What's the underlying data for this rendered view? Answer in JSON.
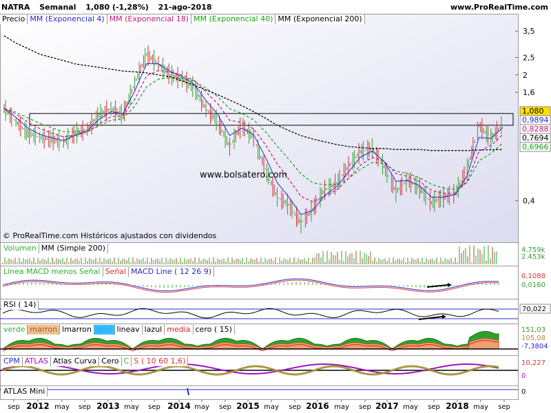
{
  "header": {
    "symbol": "NATRA",
    "period": "Semanal",
    "quote": "1,080 (-1,28%)",
    "date": "21-ago-2018",
    "site": "www.ProRealTime.com"
  },
  "watermark": "www.bolsatero.com",
  "footer_note": "© ProRealTime.com  Históricos ajustados con dividendos",
  "colors": {
    "ema4": "#2a2ac8",
    "ema18": "#c81478",
    "ema40": "#14a014",
    "ema200": "#000000",
    "volume": "#2fb02f",
    "macd_hist": "#2fb02f",
    "rsi": "#000000",
    "cpm_purple": "#a010c0",
    "highlight_box": "#000000",
    "price_box_yellow": "#ffe000"
  },
  "panels": {
    "price": {
      "legend": [
        "Precio",
        "MM (Exponencial 4)",
        "MM (Exponencial 18)",
        "MM (Exponencial 40)",
        "MM (Exponencial 200)"
      ],
      "y_ticks": [
        "3,5",
        "2,5",
        "2",
        "1,6",
        "0,4"
      ],
      "price_tags": [
        {
          "text": "1,080",
          "kind": "last"
        },
        {
          "text": "0,9894",
          "kind": "ema4"
        },
        {
          "text": "0,8288",
          "kind": "ema18"
        },
        {
          "text": "0,7694",
          "kind": "ema200"
        },
        {
          "text": "0,6966",
          "kind": "ema40"
        }
      ]
    },
    "volume": {
      "legend": [
        "Volumen",
        "MM (Simple 200)"
      ],
      "tags": [
        "4.759k",
        "2.453k"
      ]
    },
    "macd": {
      "legend": [
        "Línea MACD menos Señal",
        "Señal",
        "MACD Line ( 12 26 9)"
      ],
      "tags": [
        "0,1088",
        "0,0160"
      ]
    },
    "rsi": {
      "legend": [
        "RSI ( 14)"
      ],
      "tags": [
        "70,022"
      ]
    },
    "atlas_curva": {
      "legend": [
        "verde",
        "marron",
        "lmarron",
        "azul",
        "lineav",
        "lazul",
        "media",
        "cero ( 15)"
      ],
      "tags": [
        "151,03",
        "105,08",
        "-7,3804"
      ]
    },
    "cpm": {
      "legend": [
        "CPM",
        "ATLAS",
        "Atlas Curva",
        "Cero",
        "C",
        "S ( 10 60 1,6)"
      ],
      "tags": [
        "10,227",
        "0"
      ]
    },
    "atlas_mini": {
      "legend": [
        "ATLAS Mini"
      ],
      "tags": [
        "0"
      ]
    }
  },
  "x_axis": [
    "sep",
    "2012",
    "may",
    "sep",
    "2013",
    "may",
    "sep",
    "2014",
    "may",
    "sep",
    "2015",
    "may",
    "sep",
    "2016",
    "may",
    "sep",
    "2017",
    "may",
    "sep",
    "2018",
    "may",
    "sep"
  ],
  "chart_data": {
    "type": "line",
    "title": "NATRA Semanal",
    "ylabel": "Precio",
    "x": [
      "2011-09",
      "2011-11",
      "2012-01",
      "2012-03",
      "2012-05",
      "2012-07",
      "2012-09",
      "2012-11",
      "2013-01",
      "2013-03",
      "2013-05",
      "2013-07",
      "2013-09",
      "2013-11",
      "2014-01",
      "2014-03",
      "2014-05",
      "2014-07",
      "2014-09",
      "2014-11",
      "2015-01",
      "2015-03",
      "2015-05",
      "2015-07",
      "2015-09",
      "2015-11",
      "2016-01",
      "2016-03",
      "2016-05",
      "2016-07",
      "2016-09",
      "2016-11",
      "2017-01",
      "2017-03",
      "2017-05",
      "2017-07",
      "2017-09",
      "2017-11",
      "2018-01",
      "2018-03",
      "2018-05",
      "2018-07",
      "2018-08"
    ],
    "series": [
      {
        "name": "Precio",
        "values": [
          1.3,
          1.1,
          0.95,
          0.9,
          0.88,
          0.85,
          0.95,
          1.0,
          1.2,
          1.3,
          1.2,
          1.8,
          2.6,
          2.3,
          2.0,
          1.9,
          1.7,
          1.3,
          1.1,
          0.8,
          1.05,
          0.9,
          0.6,
          0.42,
          0.38,
          0.3,
          0.36,
          0.46,
          0.5,
          0.62,
          0.75,
          0.78,
          0.62,
          0.45,
          0.52,
          0.47,
          0.39,
          0.42,
          0.44,
          0.6,
          1.05,
          0.88,
          1.08
        ]
      },
      {
        "name": "MM (Exponencial 200)",
        "values": [
          3.3,
          3.0,
          2.8,
          2.6,
          2.5,
          2.4,
          2.3,
          2.25,
          2.2,
          2.15,
          2.1,
          2.08,
          2.05,
          2.0,
          1.95,
          1.85,
          1.75,
          1.65,
          1.55,
          1.45,
          1.35,
          1.25,
          1.15,
          1.05,
          0.98,
          0.92,
          0.88,
          0.85,
          0.82,
          0.8,
          0.79,
          0.78,
          0.78,
          0.77,
          0.77,
          0.77,
          0.76,
          0.76,
          0.76,
          0.76,
          0.765,
          0.768,
          0.7694
        ]
      }
    ],
    "yscale": "log",
    "ylim": [
      0.25,
      4.0
    ],
    "grid": false
  }
}
